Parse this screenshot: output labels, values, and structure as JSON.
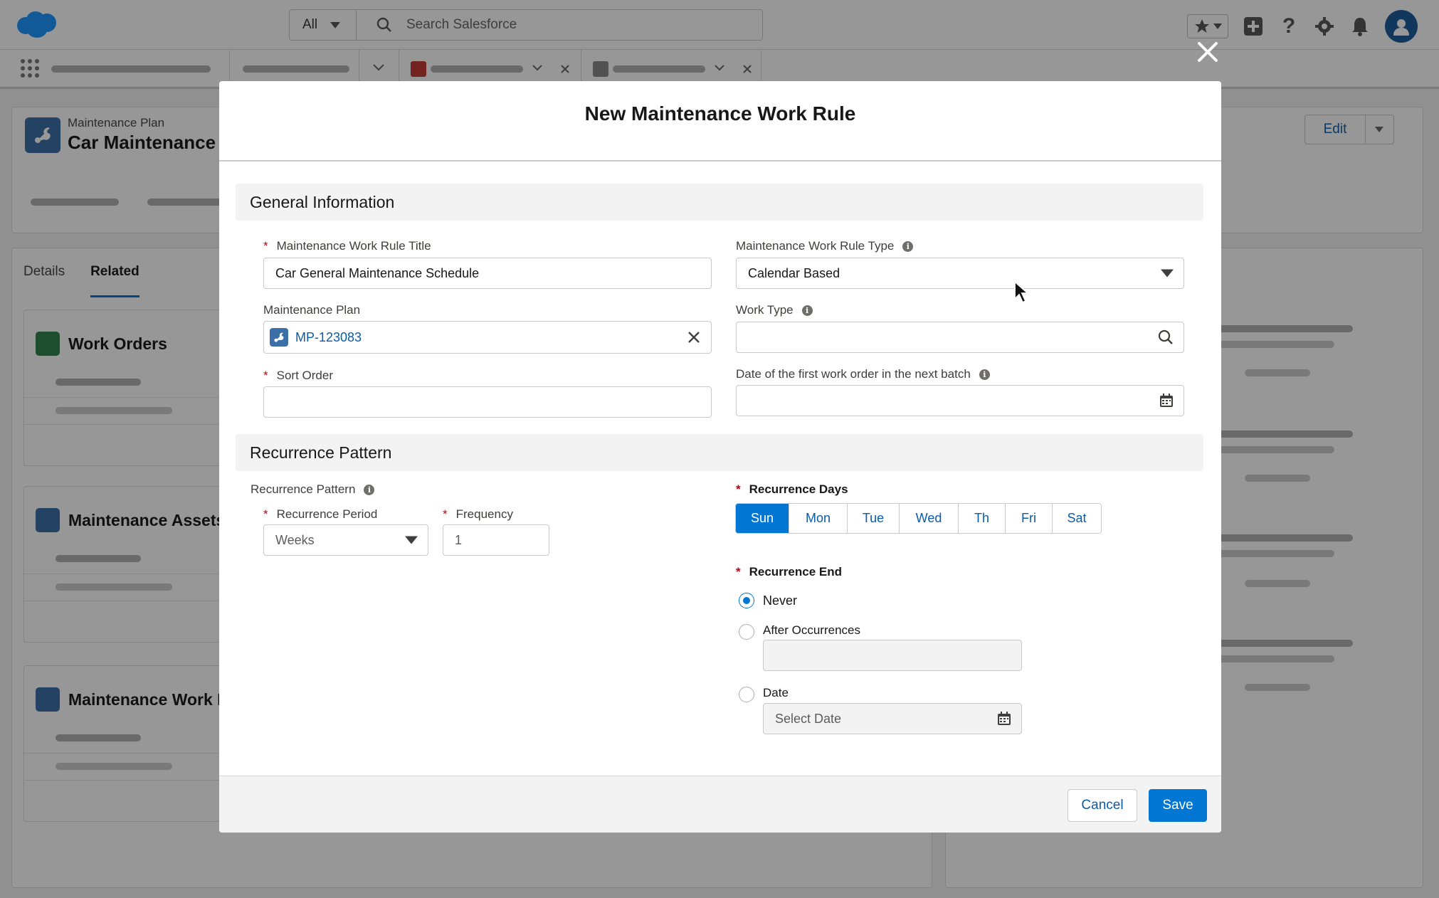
{
  "global_header": {
    "search_scope": "All",
    "search_placeholder": "Search Salesforce"
  },
  "record": {
    "object_label": "Maintenance Plan",
    "title": "Car Maintenance",
    "edit_label": "Edit",
    "tabs": [
      "Details",
      "Related"
    ],
    "active_tab": "Related",
    "related_lists": [
      "Work Orders",
      "Maintenance Assets",
      "Maintenance Work Rules"
    ]
  },
  "modal": {
    "title": "New Maintenance Work Rule",
    "general_section": "General Information",
    "title_field": {
      "label": "Maintenance Work Rule Title",
      "value": "Car General Maintenance Schedule",
      "required": true
    },
    "type_field": {
      "label": "Maintenance Work Rule Type",
      "value": "Calendar Based"
    },
    "plan_field": {
      "label": "Maintenance Plan",
      "value": "MP-123083"
    },
    "work_type_field": {
      "label": "Work Type",
      "value": ""
    },
    "sort_order_field": {
      "label": "Sort Order",
      "value": "",
      "required": true
    },
    "first_wo_date_field": {
      "label": "Date of the first work order in the next batch",
      "value": ""
    },
    "recurrence_section": "Recurrence Pattern",
    "recurrence_pattern_label": "Recurrence Pattern",
    "recurrence_period": {
      "label": "Recurrence Period",
      "value": "Weeks"
    },
    "frequency": {
      "label": "Frequency",
      "value": "1"
    },
    "recurrence_days": {
      "label": "Recurrence Days",
      "days": [
        "Sun",
        "Mon",
        "Tue",
        "Wed",
        "Th",
        "Fri",
        "Sat"
      ],
      "selected": [
        "Sun"
      ]
    },
    "recurrence_end": {
      "label": "Recurrence End",
      "options": [
        "Never",
        "After Occurrences",
        "Date"
      ],
      "selected": "Never",
      "date_placeholder": "Select Date"
    },
    "cancel_label": "Cancel",
    "save_label": "Save"
  },
  "colors": {
    "brand": "#0176d3",
    "link": "#0b5cab",
    "required": "#ba0517"
  }
}
